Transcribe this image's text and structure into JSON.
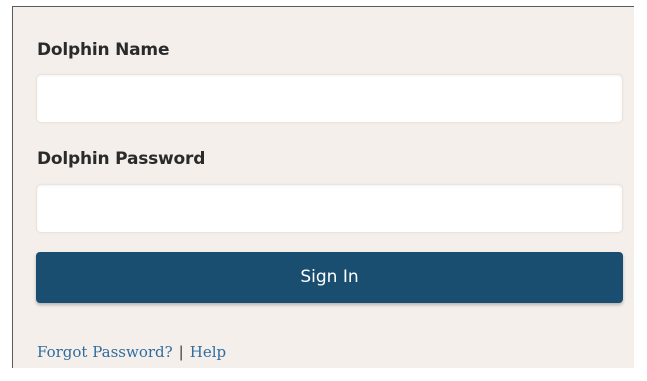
{
  "login": {
    "name_label": "Dolphin Name",
    "name_value": "",
    "password_label": "Dolphin Password",
    "password_value": "",
    "signin_label": "Sign In",
    "forgot_link": "Forgot Password?",
    "separator": "|",
    "help_link": "Help"
  },
  "colors": {
    "panel_bg": "#f4efeb",
    "button_bg": "#1a4e71",
    "link": "#2f6c9e"
  }
}
